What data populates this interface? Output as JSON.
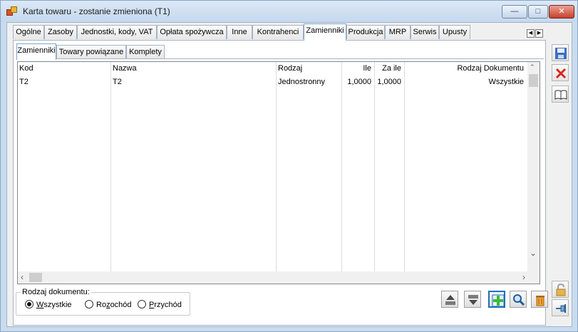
{
  "window": {
    "title": "Karta towaru - zostanie zmieniona (T1)"
  },
  "tabs_top": [
    "Ogólne",
    "Zasoby",
    "Jednostki, kody, VAT",
    "Opłata spożywcza",
    "Inne",
    "Kontrahenci",
    "Zamienniki",
    "Produkcja",
    "MRP",
    "Serwis",
    "Upusty"
  ],
  "active_top_tab": "Zamienniki",
  "sub_tabs": [
    "Zamienniki",
    "Towary powiązane",
    "Komplety"
  ],
  "active_sub_tab": "Zamienniki",
  "grid": {
    "columns": [
      "Kod",
      "Nazwa",
      "Rodzaj",
      "Ile",
      "Za ile",
      "Rodzaj Dokumentu"
    ],
    "rows": [
      [
        "T2",
        "T2",
        "Jednostronny",
        "1,0000",
        "1,0000",
        "Wszystkie"
      ]
    ]
  },
  "doc_type": {
    "label": "Rodzaj dokumentu:",
    "options": [
      "Wszystkie",
      "Rozchód",
      "Przychód"
    ],
    "accel": [
      "W",
      "z",
      "P"
    ],
    "rest": [
      "szystkie",
      "ochód",
      "rzychód"
    ],
    "pre": [
      "",
      "Ro",
      ""
    ],
    "selected": "Wszystkie"
  },
  "icons": {
    "bottom": [
      "export-up-icon",
      "import-down-icon",
      "add-icon",
      "search-icon",
      "delete-icon"
    ],
    "right": [
      "save-icon",
      "cancel-icon",
      "book-icon",
      "lock-icon",
      "pin-icon"
    ]
  },
  "colors": {
    "accent": "#1e6fb8",
    "cancel": "#d9281c",
    "add": "#3db83a"
  }
}
